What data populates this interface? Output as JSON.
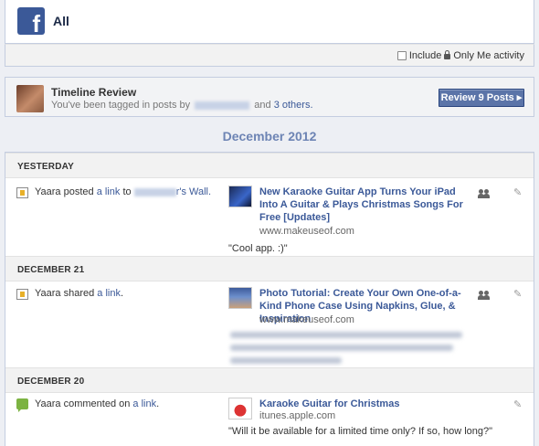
{
  "header": {
    "logo_letter": "f",
    "title": "All"
  },
  "filter": {
    "include_label": "Include",
    "only_me_label": "Only Me activity",
    "checked": false
  },
  "review": {
    "title": "Timeline Review",
    "subtitle_prefix": "You've been tagged in posts by",
    "subtitle_and": "and",
    "others_link": "3 others.",
    "button_label": "Review 9 Posts ▸"
  },
  "month_label": "December 2012",
  "sections": [
    {
      "heading": "YESTERDAY",
      "activity": {
        "actor": "Yaara posted",
        "link": "a link",
        "to": "to",
        "wall_suffix": "r's Wall."
      },
      "story": {
        "title": "New Karaoke Guitar App Turns Your iPad Into A Guitar & Plays Christmas Songs For Free [Updates]",
        "source": "www.makeuseof.com",
        "quote": "\"Cool app. :)\""
      }
    },
    {
      "heading": "DECEMBER 21",
      "activity": {
        "actor": "Yaara shared",
        "link": "a link",
        "end": "."
      },
      "story": {
        "title": "Photo Tutorial: Create Your Own One-of-a-Kind Phone Case Using Napkins, Glue, & Inspiration",
        "source": "www.makeuseof.com"
      }
    },
    {
      "heading": "DECEMBER 20",
      "activity": {
        "actor": "Yaara commented on",
        "link": "a link",
        "end": "."
      },
      "story": {
        "title": "Karaoke Guitar for Christmas",
        "source": "itunes.apple.com",
        "quote": "\"Will it be available for a limited time only? If so, how long?\""
      }
    }
  ],
  "icons": {
    "post": "post-link-icon",
    "comment": "comment-icon",
    "audience": "friends-audience-icon",
    "edit": "pencil-icon",
    "lock": "lock-icon",
    "logo": "facebook-logo-icon"
  }
}
